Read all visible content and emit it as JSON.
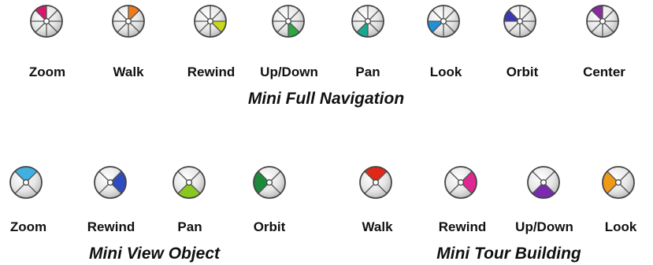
{
  "sections": [
    {
      "title": "Mini Full Navigation",
      "wheels": [
        {
          "label": "Zoom",
          "color": "#d8186e"
        },
        {
          "label": "Walk",
          "color": "#f07a18"
        },
        {
          "label": "Rewind",
          "color": "#c8d81c"
        },
        {
          "label": "Up/Down",
          "color": "#2aa844"
        },
        {
          "label": "Pan",
          "color": "#18a890"
        },
        {
          "label": "Look",
          "color": "#2090d8"
        },
        {
          "label": "Orbit",
          "color": "#3a38b0"
        },
        {
          "label": "Center",
          "color": "#8a2aa0"
        }
      ]
    },
    {
      "title": "Mini View Object",
      "wheels": [
        {
          "label": "Zoom",
          "color": "#40b0e0"
        },
        {
          "label": "Rewind",
          "color": "#2c4cc0"
        },
        {
          "label": "Pan",
          "color": "#8ac820"
        },
        {
          "label": "Orbit",
          "color": "#1c8a3a"
        }
      ]
    },
    {
      "title": "Mini Tour Building",
      "wheels": [
        {
          "label": "Walk",
          "color": "#e02818"
        },
        {
          "label": "Rewind",
          "color": "#e02890"
        },
        {
          "label": "Up/Down",
          "color": "#7a2ab0"
        },
        {
          "label": "Look",
          "color": "#f09818"
        }
      ]
    }
  ]
}
